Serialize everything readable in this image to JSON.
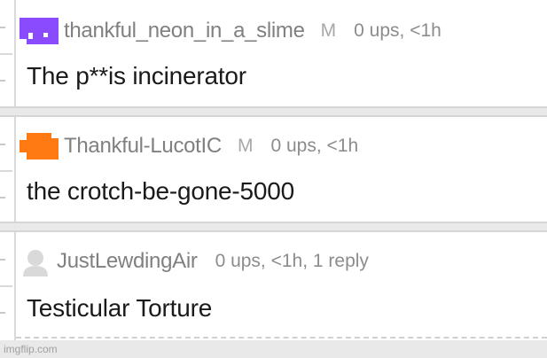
{
  "comments": [
    {
      "username": "thankful_neon_in_a_slime",
      "badge": "M",
      "stats": "0 ups, <1h",
      "text": "The p**is incinerator",
      "avatar_icon": "purple-block-avatar-icon",
      "avatar_color": "#8a4bff"
    },
    {
      "username": "Thankful-LucotIC",
      "badge": "M",
      "stats": "0 ups, <1h",
      "text": "the crotch-be-gone-5000",
      "avatar_icon": "orange-block-avatar-icon",
      "avatar_color": "#ff7a12"
    },
    {
      "username": "JustLewdingAir",
      "badge": "",
      "stats": "0 ups, <1h, 1 reply",
      "text": "Testicular Torture",
      "avatar_icon": "default-user-avatar-icon",
      "avatar_color": "#d9d9d9"
    }
  ],
  "watermark": "imgflip.com"
}
